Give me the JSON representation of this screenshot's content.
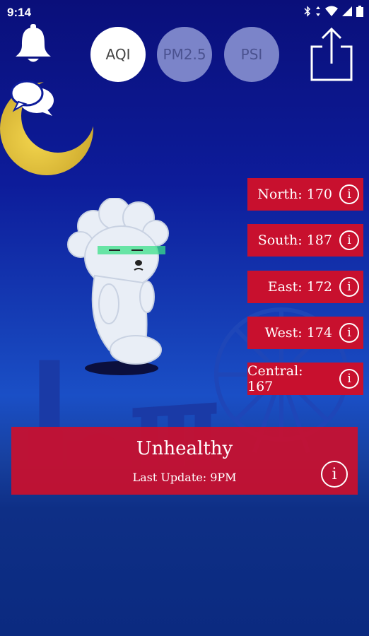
{
  "status_bar": {
    "time": "9:14",
    "icons": [
      "bluetooth-icon",
      "data-arrows-icon",
      "wifi-icon",
      "signal-icon",
      "battery-icon"
    ]
  },
  "tabs": [
    {
      "label": "AQI",
      "active": true
    },
    {
      "label": "PM2.5",
      "active": false
    },
    {
      "label": "PSI",
      "active": false
    }
  ],
  "regions": [
    {
      "label": "North: 170",
      "info": "i"
    },
    {
      "label": "South: 187",
      "info": "i"
    },
    {
      "label": "East: 172",
      "info": "i"
    },
    {
      "label": "West: 174",
      "info": "i"
    },
    {
      "label": "Central: 167",
      "info": "i"
    }
  ],
  "status": {
    "title": "Unhealthy",
    "last_update": "Last Update: 9PM",
    "info": "i"
  },
  "colors": {
    "accent_red": "#c8102e",
    "sky_top": "#0a0f7a",
    "sky_bottom": "#0b2a80",
    "moon": "#e2c23a"
  }
}
